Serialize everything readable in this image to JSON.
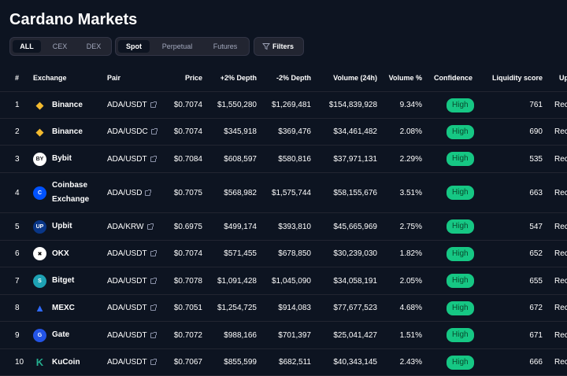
{
  "page": {
    "title": "Cardano Markets"
  },
  "filters": {
    "type_options": [
      "ALL",
      "CEX",
      "DEX"
    ],
    "type_active": "ALL",
    "market_options": [
      "Spot",
      "Perpetual",
      "Futures"
    ],
    "market_active": "Spot",
    "filters_label": "Filters"
  },
  "table": {
    "headers": {
      "rank": "#",
      "exchange": "Exchange",
      "pair": "Pair",
      "price": "Price",
      "depth_plus": "+2% Depth",
      "depth_minus": "-2% Depth",
      "volume": "Volume (24h)",
      "volume_pct": "Volume %",
      "confidence": "Confidence",
      "liquidity": "Liquidity score",
      "updated": "Up"
    },
    "rows": [
      {
        "rank": "1",
        "exchange": "Binance",
        "logo": "binance-logo",
        "pair": "ADA/USDT",
        "price": "$0.7074",
        "depth_plus": "$1,550,280",
        "depth_minus": "$1,269,481",
        "volume": "$154,839,928",
        "volume_pct": "9.34%",
        "confidence": "High",
        "liquidity": "761",
        "updated": "Rec"
      },
      {
        "rank": "2",
        "exchange": "Binance",
        "logo": "binance-logo",
        "pair": "ADA/USDC",
        "price": "$0.7074",
        "depth_plus": "$345,918",
        "depth_minus": "$369,476",
        "volume": "$34,461,482",
        "volume_pct": "2.08%",
        "confidence": "High",
        "liquidity": "690",
        "updated": "Rec"
      },
      {
        "rank": "3",
        "exchange": "Bybit",
        "logo": "bybit-logo",
        "pair": "ADA/USDT",
        "price": "$0.7084",
        "depth_plus": "$608,597",
        "depth_minus": "$580,816",
        "volume": "$37,971,131",
        "volume_pct": "2.29%",
        "confidence": "High",
        "liquidity": "535",
        "updated": "Rec"
      },
      {
        "rank": "4",
        "exchange": "Coinbase Exchange",
        "logo": "coinbase-logo",
        "pair": "ADA/USD",
        "price": "$0.7075",
        "depth_plus": "$568,982",
        "depth_minus": "$1,575,744",
        "volume": "$58,155,676",
        "volume_pct": "3.51%",
        "confidence": "High",
        "liquidity": "663",
        "updated": "Rec"
      },
      {
        "rank": "5",
        "exchange": "Upbit",
        "logo": "upbit-logo",
        "pair": "ADA/KRW",
        "price": "$0.6975",
        "depth_plus": "$499,174",
        "depth_minus": "$393,810",
        "volume": "$45,665,969",
        "volume_pct": "2.75%",
        "confidence": "High",
        "liquidity": "547",
        "updated": "Rec"
      },
      {
        "rank": "6",
        "exchange": "OKX",
        "logo": "okx-logo",
        "pair": "ADA/USDT",
        "price": "$0.7074",
        "depth_plus": "$571,455",
        "depth_minus": "$678,850",
        "volume": "$30,239,030",
        "volume_pct": "1.82%",
        "confidence": "High",
        "liquidity": "652",
        "updated": "Rec"
      },
      {
        "rank": "7",
        "exchange": "Bitget",
        "logo": "bitget-logo",
        "pair": "ADA/USDT",
        "price": "$0.7078",
        "depth_plus": "$1,091,428",
        "depth_minus": "$1,045,090",
        "volume": "$34,058,191",
        "volume_pct": "2.05%",
        "confidence": "High",
        "liquidity": "655",
        "updated": "Rec"
      },
      {
        "rank": "8",
        "exchange": "MEXC",
        "logo": "mexc-logo",
        "pair": "ADA/USDT",
        "price": "$0.7051",
        "depth_plus": "$1,254,725",
        "depth_minus": "$914,083",
        "volume": "$77,677,523",
        "volume_pct": "4.68%",
        "confidence": "High",
        "liquidity": "672",
        "updated": "Rec"
      },
      {
        "rank": "9",
        "exchange": "Gate",
        "logo": "gate-logo",
        "pair": "ADA/USDT",
        "price": "$0.7072",
        "depth_plus": "$988,166",
        "depth_minus": "$701,397",
        "volume": "$25,041,427",
        "volume_pct": "1.51%",
        "confidence": "High",
        "liquidity": "671",
        "updated": "Rec"
      },
      {
        "rank": "10",
        "exchange": "KuCoin",
        "logo": "kucoin-logo",
        "pair": "ADA/USDT",
        "price": "$0.7067",
        "depth_plus": "$855,599",
        "depth_minus": "$682,511",
        "volume": "$40,343,145",
        "volume_pct": "2.43%",
        "confidence": "High",
        "liquidity": "666",
        "updated": "Rec"
      }
    ]
  },
  "colors": {
    "background": "#0d1421",
    "accent_link": "#6188ff",
    "confidence_high": "#16c784"
  }
}
